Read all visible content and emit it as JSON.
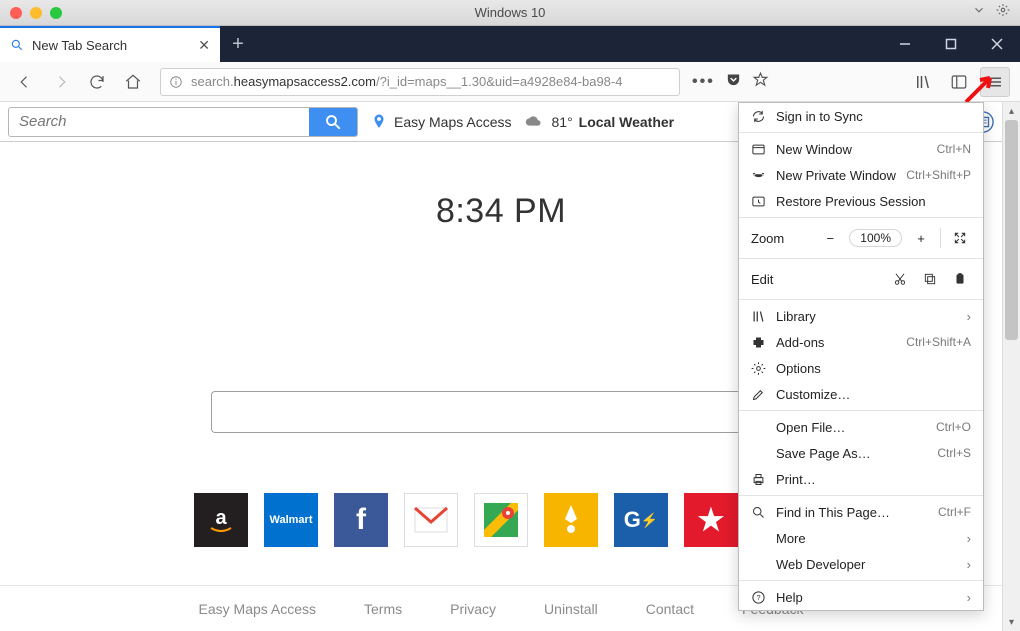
{
  "mac": {
    "title": "Windows 10"
  },
  "tab": {
    "title": "New Tab Search"
  },
  "url": {
    "prefix": "search.",
    "host": "heasymapsaccess2.com",
    "path": "/?i_id=maps__1.30&uid=a4928e84-ba98-4"
  },
  "ctoolbar": {
    "search_placeholder": "Search",
    "maps_label": "Easy Maps Access",
    "temp": "81°",
    "weather_label": "Local Weather"
  },
  "clock": "8:34 PM",
  "footer": [
    "Easy Maps Access",
    "Terms",
    "Privacy",
    "Uninstall",
    "Contact",
    "Feedback"
  ],
  "menu": {
    "sign_in": "Sign in to Sync",
    "new_window": {
      "label": "New Window",
      "sc": "Ctrl+N"
    },
    "new_private": {
      "label": "New Private Window",
      "sc": "Ctrl+Shift+P"
    },
    "restore": "Restore Previous Session",
    "zoom": {
      "label": "Zoom",
      "value": "100%"
    },
    "edit": "Edit",
    "library": "Library",
    "addons": {
      "label": "Add-ons",
      "sc": "Ctrl+Shift+A"
    },
    "options": "Options",
    "customize": "Customize…",
    "open_file": {
      "label": "Open File…",
      "sc": "Ctrl+O"
    },
    "save_as": {
      "label": "Save Page As…",
      "sc": "Ctrl+S"
    },
    "print": "Print…",
    "find": {
      "label": "Find in This Page…",
      "sc": "Ctrl+F"
    },
    "more": "More",
    "webdev": "Web Developer",
    "help": "Help"
  }
}
